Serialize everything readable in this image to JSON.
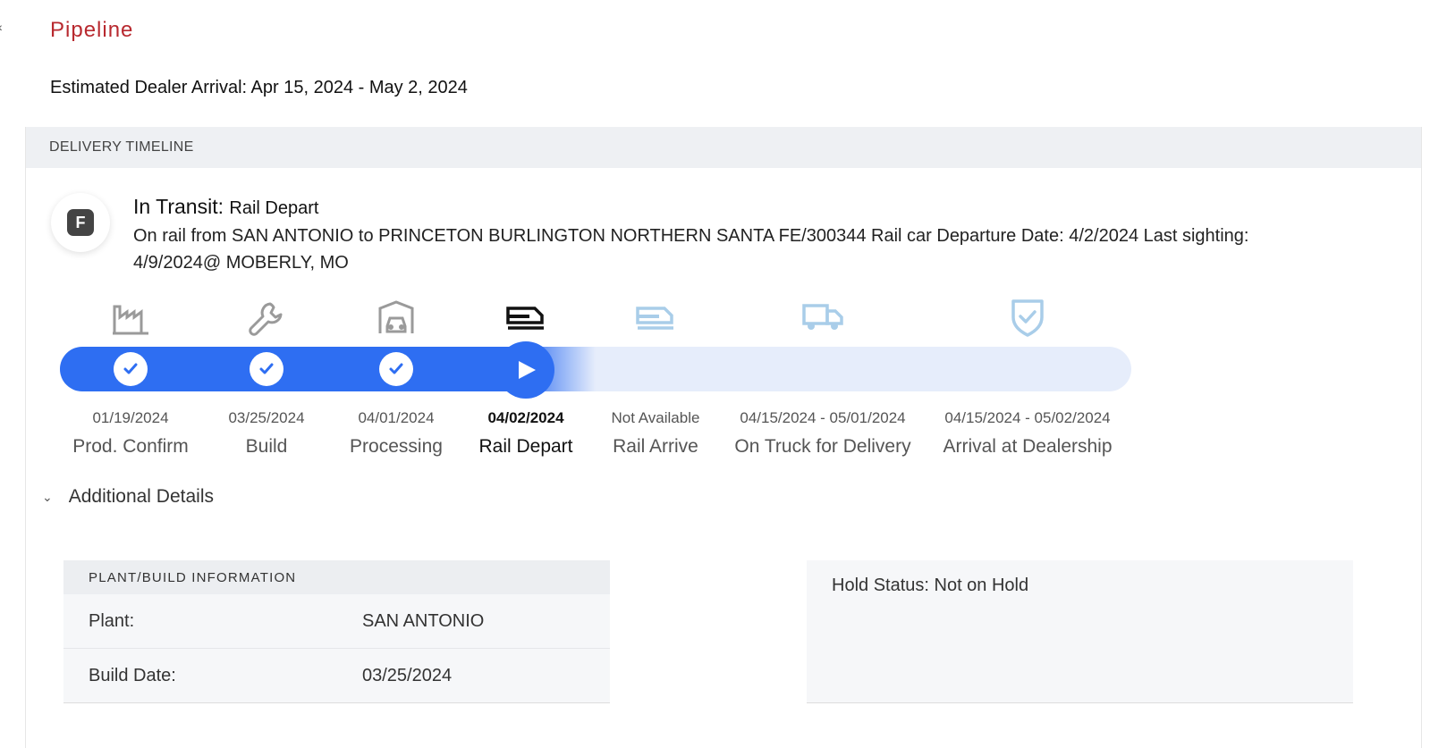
{
  "header": {
    "title": "Pipeline",
    "arrival": "Estimated Dealer Arrival: Apr 15, 2024 - May 2, 2024"
  },
  "timeline": {
    "section_title": "DELIVERY TIMELINE",
    "brand_letter": "F",
    "status_label": "In Transit:",
    "status_stage": "Rail Depart",
    "description": "On rail from SAN ANTONIO to PRINCETON BURLINGTON NORTHERN SANTA FE/300344 Rail car Departure Date: 4/2/2024 Last sighting: 4/9/2024@ MOBERLY, MO",
    "progress_fraction": 0.5,
    "stages": [
      {
        "label": "Prod. Confirm",
        "date": "01/19/2024",
        "state": "complete",
        "icon": "factory-icon"
      },
      {
        "label": "Build",
        "date": "03/25/2024",
        "state": "complete",
        "icon": "wrench-icon"
      },
      {
        "label": "Processing",
        "date": "04/01/2024",
        "state": "complete",
        "icon": "car-garage-icon"
      },
      {
        "label": "Rail Depart",
        "date": "04/02/2024",
        "state": "current",
        "icon": "rail-car-icon"
      },
      {
        "label": "Rail Arrive",
        "date": "Not Available",
        "state": "upcoming",
        "icon": "rail-car-icon"
      },
      {
        "label": "On Truck for Delivery",
        "date": "04/15/2024 - 05/01/2024",
        "state": "upcoming",
        "icon": "truck-icon"
      },
      {
        "label": "Arrival at Dealership",
        "date": "04/15/2024 - 05/02/2024",
        "state": "upcoming",
        "icon": "shield-check-icon"
      }
    ],
    "colors": {
      "accent": "#2e6ef2",
      "track": "#e6edfb",
      "complete_icon": "#9a9a9a",
      "upcoming_icon": "#a9cde9",
      "title_red": "#b8292f"
    }
  },
  "details": {
    "toggle_label": "Additional Details",
    "plant_build": {
      "title": "PLANT/BUILD INFORMATION",
      "rows": [
        {
          "key": "Plant:",
          "value": "SAN ANTONIO"
        },
        {
          "key": "Build Date:",
          "value": "03/25/2024"
        }
      ]
    },
    "hold_status": "Hold Status: Not on Hold"
  }
}
